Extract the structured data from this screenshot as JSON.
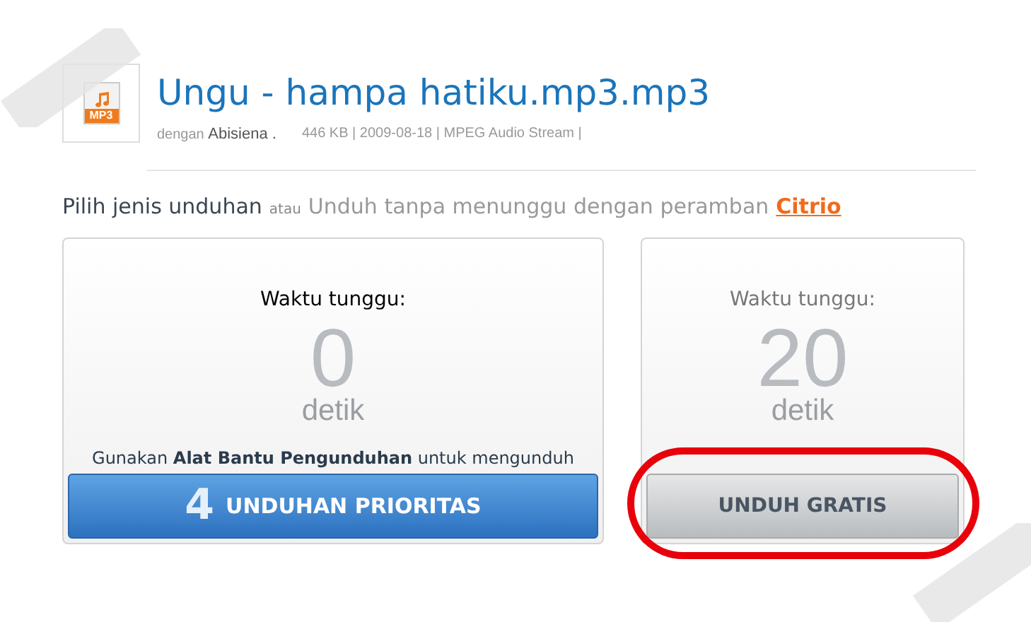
{
  "file": {
    "title": "Ungu - hampa hatiku.mp3.mp3",
    "icon_label": "MP3",
    "by_label": "dengan",
    "uploader": "Abisiena .",
    "meta": "446 KB | 2009-08-18 | MPEG Audio Stream |"
  },
  "heading": {
    "main": "Pilih jenis unduhan",
    "or": "atau",
    "alt": "Unduh tanpa menunggu dengan peramban",
    "link": "Citrio"
  },
  "options": [
    {
      "kind": "priority",
      "wait_label": "Waktu tunggu:",
      "count": "0",
      "unit": "detik",
      "note": "Gunakan **Alat Bantu Pengunduhan** untuk mengunduh",
      "button_mark": "4",
      "button": "UNDUHAN PRIORITAS",
      "highlighted": false
    },
    {
      "kind": "free",
      "wait_label": "Waktu tunggu:",
      "count": "20",
      "unit": "detik",
      "button": "UNDUH GRATIS",
      "highlighted": true
    }
  ]
}
